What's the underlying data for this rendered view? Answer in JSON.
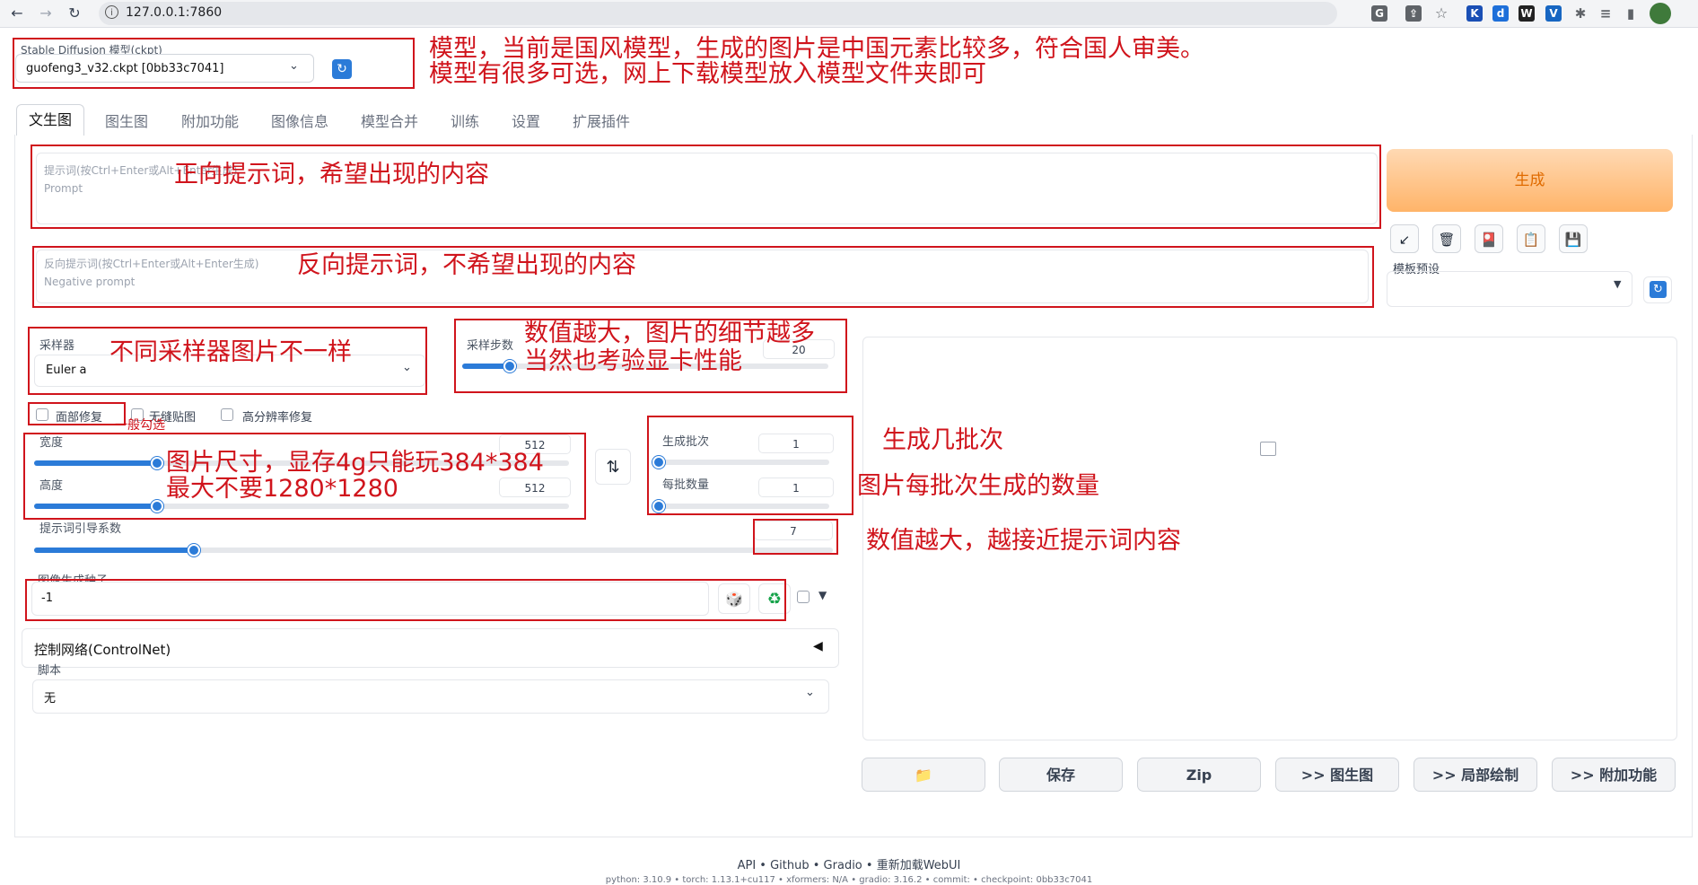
{
  "browser": {
    "url": "127.0.0.1:7860"
  },
  "model": {
    "label": "Stable Diffusion 模型(ckpt)",
    "value": "guofeng3_v32.ckpt [0bb33c7041]"
  },
  "tabs": [
    "文生图",
    "图生图",
    "附加功能",
    "图像信息",
    "模型合并",
    "训练",
    "设置",
    "扩展插件"
  ],
  "prompt": {
    "placeholder_line1": "提示词(按Ctrl+Enter或Alt+Enter生成)",
    "placeholder_line2": "Prompt"
  },
  "negative": {
    "placeholder_line1": "反向提示词(按Ctrl+Enter或Alt+Enter生成)",
    "placeholder_line2": "Negative prompt"
  },
  "generate": {
    "label": "生成"
  },
  "tools": {
    "arrow": "↙",
    "trash": "🗑",
    "card": "🎴",
    "clipboard": "📋",
    "save": "💾"
  },
  "preset": {
    "label": "模板预设"
  },
  "sampler": {
    "label": "采样器",
    "value": "Euler a"
  },
  "steps": {
    "label": "采样步数",
    "value": "20",
    "fraction": 0.13
  },
  "checkboxes": [
    "面部修复",
    "无缝贴图",
    "高分辨率修复"
  ],
  "width": {
    "label": "宽度",
    "value": "512",
    "fraction": 0.23
  },
  "height": {
    "label": "高度",
    "value": "512",
    "fraction": 0.23
  },
  "swap_icon": "⇅",
  "batch_count": {
    "label": "生成批次",
    "value": "1",
    "fraction": 0.0
  },
  "batch_size": {
    "label": "每批数量",
    "value": "1",
    "fraction": 0.0
  },
  "cfg": {
    "label": "提示词引导系数",
    "value": "7",
    "fraction": 0.2
  },
  "seed": {
    "label": "图像生成种子",
    "value": "-1",
    "dice": "🎲",
    "recycle": "♻"
  },
  "controlnet": {
    "label": "控制网络(ControlNet)",
    "toggle": "◀"
  },
  "script": {
    "label": "脚本",
    "value": "无"
  },
  "output_buttons": [
    "📁",
    "保存",
    "Zip",
    ">> 图生图",
    ">> 局部绘制",
    ">> 附加功能"
  ],
  "footer": {
    "links": "API • Github • Gradio • 重新加载WebUI",
    "versions": "python: 3.10.9  •  torch: 1.13.1+cu117  •  xformers: N/A  •  gradio: 3.16.2  •  commit:  •  checkpoint: 0bb33c7041"
  },
  "annotations": {
    "model_1": "模型，当前是国风模型，生成的图片是中国元素比较多，符合国人审美。",
    "model_2": "模型有很多可选，网上下载模型放入模型文件夹即可",
    "prompt": "正向提示词，希望出现的内容",
    "negative": "反向提示词，不希望出现的内容",
    "sampler": "不同采样器图片不一样",
    "steps_1": "数值越大，图片的细节越多",
    "steps_2": "当然也考验显卡性能",
    "face": "一般勾选",
    "size_1": "图片尺寸，显存4g只能玩384*384",
    "size_2": "最大不要1280*1280",
    "batch_count": "生成几批次",
    "batch_size": "图片每批次生成的数量",
    "cfg": "数值越大，越接近提示词内容"
  },
  "colors": {
    "accent": "#2b7bd8",
    "annotation": "#d0141c",
    "generate_text": "#e06b00"
  }
}
